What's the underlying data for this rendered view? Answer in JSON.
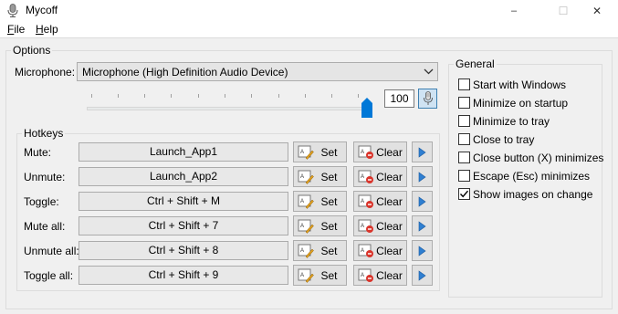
{
  "window": {
    "title": "Mycoff",
    "minimize_glyph": "–",
    "maximize_glyph": "☐",
    "close_glyph": "✕"
  },
  "menu": {
    "file_hotkey": "F",
    "file_rest": "ile",
    "help_hotkey": "H",
    "help_rest": "elp"
  },
  "options": {
    "group_label": "Options",
    "microphone_label": "Microphone:",
    "microphone_value": "Microphone (High Definition Audio Device)",
    "volume_value": "100",
    "volume_level_percent": 100
  },
  "hotkeys": {
    "group_label": "Hotkeys",
    "set_label": "Set",
    "clear_label": "Clear",
    "rows": [
      {
        "label": "Mute:",
        "value": "Launch_App1"
      },
      {
        "label": "Unmute:",
        "value": "Launch_App2"
      },
      {
        "label": "Toggle:",
        "value": "Ctrl + Shift + M"
      },
      {
        "label": "Mute all:",
        "value": "Ctrl + Shift + 7"
      },
      {
        "label": "Unmute all:",
        "value": "Ctrl + Shift + 8"
      },
      {
        "label": "Toggle all:",
        "value": "Ctrl + Shift + 9"
      }
    ]
  },
  "general": {
    "group_label": "General",
    "checkboxes": [
      {
        "label": "Start with Windows",
        "checked": false
      },
      {
        "label": "Minimize on startup",
        "checked": false
      },
      {
        "label": "Minimize to tray",
        "checked": false
      },
      {
        "label": "Close to tray",
        "checked": false
      },
      {
        "label": "Close button (X) minimizes",
        "checked": false
      },
      {
        "label": "Escape (Esc) minimizes",
        "checked": false
      },
      {
        "label": "Show images on change",
        "checked": true
      }
    ]
  },
  "colors": {
    "accent": "#0078d7",
    "window_bg": "#f0f0f0",
    "play_arrow": "#2f7fd1"
  }
}
